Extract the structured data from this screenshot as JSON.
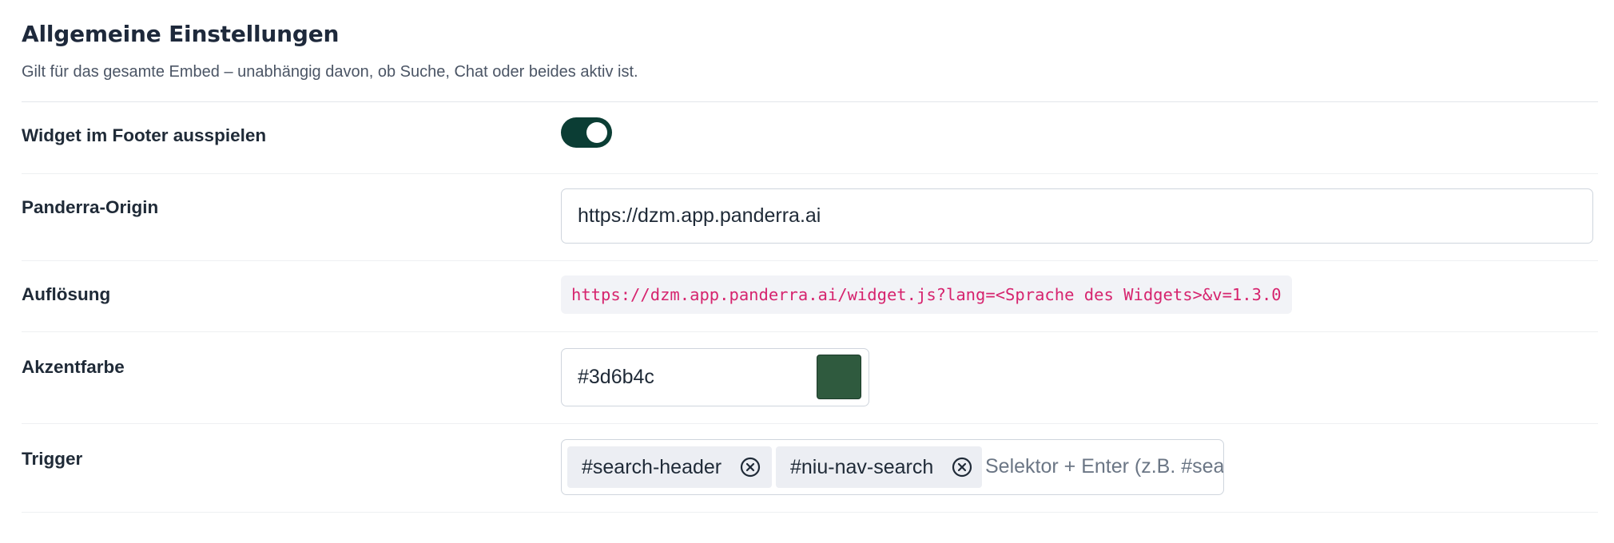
{
  "header": {
    "title": "Allgemeine Einstellungen",
    "subtitle": "Gilt für das gesamte Embed – unabhängig davon, ob Suche, Chat oder beides aktiv ist."
  },
  "settings": {
    "footer_widget": {
      "label": "Widget im Footer ausspielen",
      "enabled": true
    },
    "origin": {
      "label": "Panderra-Origin",
      "value": "https://dzm.app.panderra.ai"
    },
    "resolution": {
      "label": "Auflösung",
      "code": "https://dzm.app.panderra.ai/widget.js?lang=<Sprache des Widgets>&v=1.3.0"
    },
    "accent": {
      "label": "Akzentfarbe",
      "value": "#3d6b4c",
      "swatch_color": "#2f5a3e"
    },
    "trigger": {
      "label": "Trigger",
      "tags": [
        "#search-header",
        "#niu-nav-search"
      ],
      "placeholder": "Selektor + Enter (z.B. #search-toggle)"
    }
  },
  "colors": {
    "toggle_on": "#0b3d34",
    "code_text": "#d6246e"
  }
}
